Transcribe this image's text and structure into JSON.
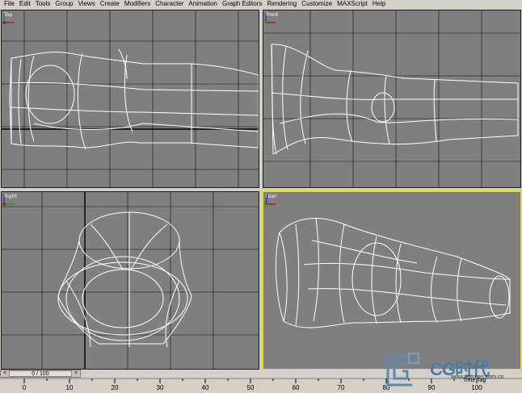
{
  "menu": {
    "items": [
      {
        "label": "File"
      },
      {
        "label": "Edit"
      },
      {
        "label": "Tools"
      },
      {
        "label": "Group"
      },
      {
        "label": "Views"
      },
      {
        "label": "Create"
      },
      {
        "label": "Modifiers"
      },
      {
        "label": "Character"
      },
      {
        "label": "Animation"
      },
      {
        "label": "Graph Editors"
      },
      {
        "label": "Rendering"
      },
      {
        "label": "Customize"
      },
      {
        "label": "MAXScript"
      },
      {
        "label": "Help"
      }
    ]
  },
  "viewports": {
    "top": {
      "label": "Top"
    },
    "front": {
      "label": "Front"
    },
    "right": {
      "label": "Right"
    },
    "user": {
      "label": "User",
      "active": true
    }
  },
  "timeline": {
    "slider_text": "0 / 100",
    "ticks": [
      "0",
      "10",
      "20",
      "30",
      "40",
      "50",
      "60",
      "70",
      "80",
      "90",
      "100"
    ]
  },
  "logo": {
    "text": "CG时代",
    "subtitle": "www.cgtimes.com.cn"
  },
  "status": {
    "text": "Time Tag"
  },
  "colors": {
    "viewport_bg": "#7f7f7f",
    "grid": "#000000",
    "wire": "#ffffff",
    "active_border": "#e8e000",
    "ui_bg": "#d4d0c8"
  }
}
